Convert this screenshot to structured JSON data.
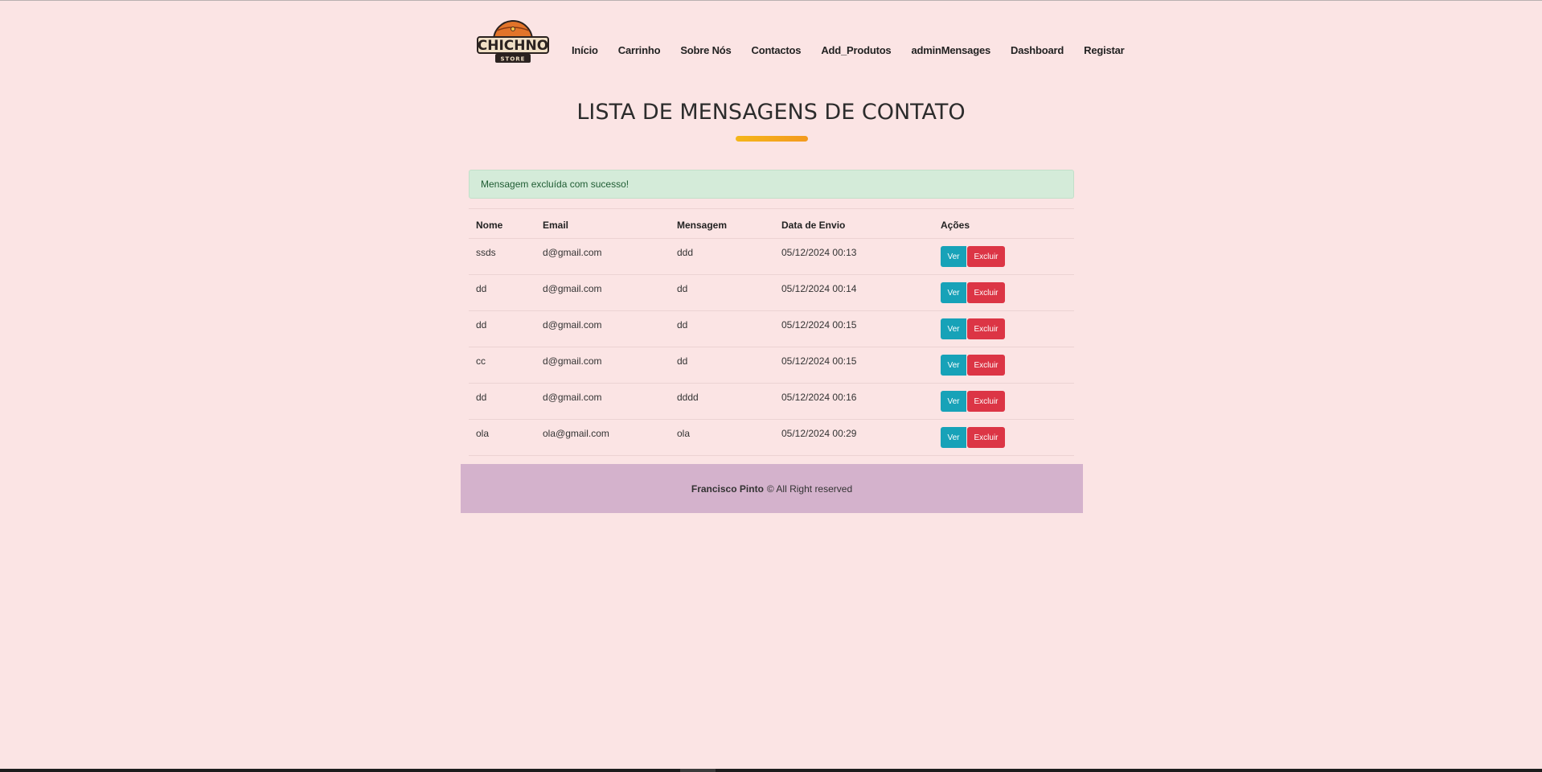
{
  "brand": {
    "logo_text": "CHICHNO",
    "logo_subtext": "STORE"
  },
  "nav": {
    "items": [
      {
        "label": "Início"
      },
      {
        "label": "Carrinho"
      },
      {
        "label": "Sobre Nós"
      },
      {
        "label": "Contactos"
      },
      {
        "label": "Add_Produtos"
      },
      {
        "label": "adminMensages"
      },
      {
        "label": "Dashboard"
      },
      {
        "label": "Registar"
      }
    ]
  },
  "page": {
    "title": "LISTA DE MENSAGENS DE CONTATO"
  },
  "alert": {
    "text": "Mensagem excluída com sucesso!"
  },
  "table": {
    "headers": {
      "nome": "Nome",
      "email": "Email",
      "mensagem": "Mensagem",
      "data": "Data de Envio",
      "acoes": "Ações"
    },
    "rows": [
      {
        "nome": "ssds",
        "email": "d@gmail.com",
        "mensagem": "ddd",
        "data": "05/12/2024 00:13"
      },
      {
        "nome": "dd",
        "email": "d@gmail.com",
        "mensagem": "dd",
        "data": "05/12/2024 00:14"
      },
      {
        "nome": "dd",
        "email": "d@gmail.com",
        "mensagem": "dd",
        "data": "05/12/2024 00:15"
      },
      {
        "nome": "cc",
        "email": "d@gmail.com",
        "mensagem": "dd",
        "data": "05/12/2024 00:15"
      },
      {
        "nome": "dd",
        "email": "d@gmail.com",
        "mensagem": "dddd",
        "data": "05/12/2024 00:16"
      },
      {
        "nome": "ola",
        "email": "ola@gmail.com",
        "mensagem": "ola",
        "data": "05/12/2024 00:29"
      }
    ],
    "action_labels": {
      "view": "Ver",
      "delete": "Excluir"
    }
  },
  "footer": {
    "author": "Francisco Pinto",
    "rights": "© All Right reserved"
  },
  "colors": {
    "background": "#fbe4e4",
    "view_button": "#17a2b8",
    "delete_button": "#dc3545",
    "alert_bg": "#d4ebd9",
    "footer_bg": "#d4b2cc",
    "accent": "#f4b61a"
  }
}
